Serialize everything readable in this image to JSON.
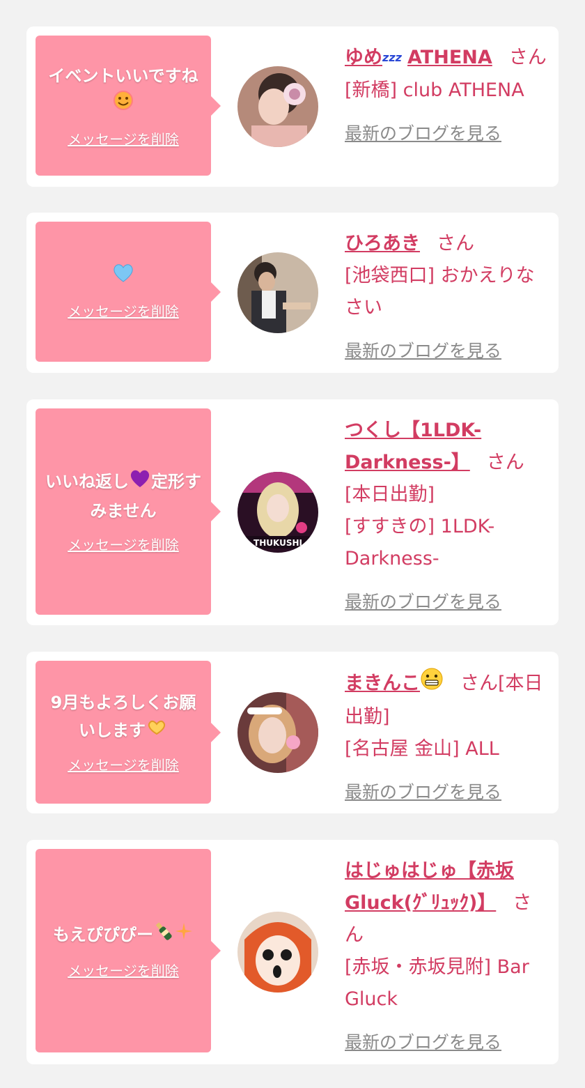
{
  "common": {
    "delete_label": "メッセージを削除",
    "blog_link": "最新のブログを見る",
    "honorific": "さん"
  },
  "cards": [
    {
      "message": "イベントいいですね",
      "message_emoji": "smiling-face-icon",
      "name": "ゆめ",
      "name_emoji": "zzz-icon",
      "name_suffix": "ATHENA",
      "honorific_suffix": "",
      "shop": "[新橋] club ATHENA"
    },
    {
      "message": "",
      "message_emoji": "light-blue-heart-icon",
      "name": "ひろあき",
      "name_suffix": "",
      "honorific_suffix": "",
      "shop": "[池袋西口] おかえりなさい"
    },
    {
      "message": "いいね返し",
      "message_emoji": "purple-heart-icon",
      "message_suffix": "定形すみません",
      "name": "つくし【1LDK-Darkness-】",
      "name_suffix": "",
      "honorific_suffix": "[本日出勤]",
      "shop": "[すすきの] 1LDK-Darkness-"
    },
    {
      "message": "9月もよろしくお願いします",
      "message_emoji": "heart-hands-icon",
      "name": "まきんこ",
      "name_emoji": "grimacing-face-icon",
      "name_suffix": "",
      "honorific_suffix": "[本日出勤]",
      "shop": "[名古屋 金山] ALL"
    },
    {
      "message": "もえぴぴぴー",
      "message_emoji": "champagne-icon",
      "message_emoji2": "sparkle-icon",
      "name": "はじゅはじゅ【赤坂Gluck(ｸﾞﾘｭｯｸ)】",
      "name_suffix": "",
      "honorific_suffix": "",
      "shop": "[赤坂・赤坂見附] Bar Gluck"
    }
  ]
}
